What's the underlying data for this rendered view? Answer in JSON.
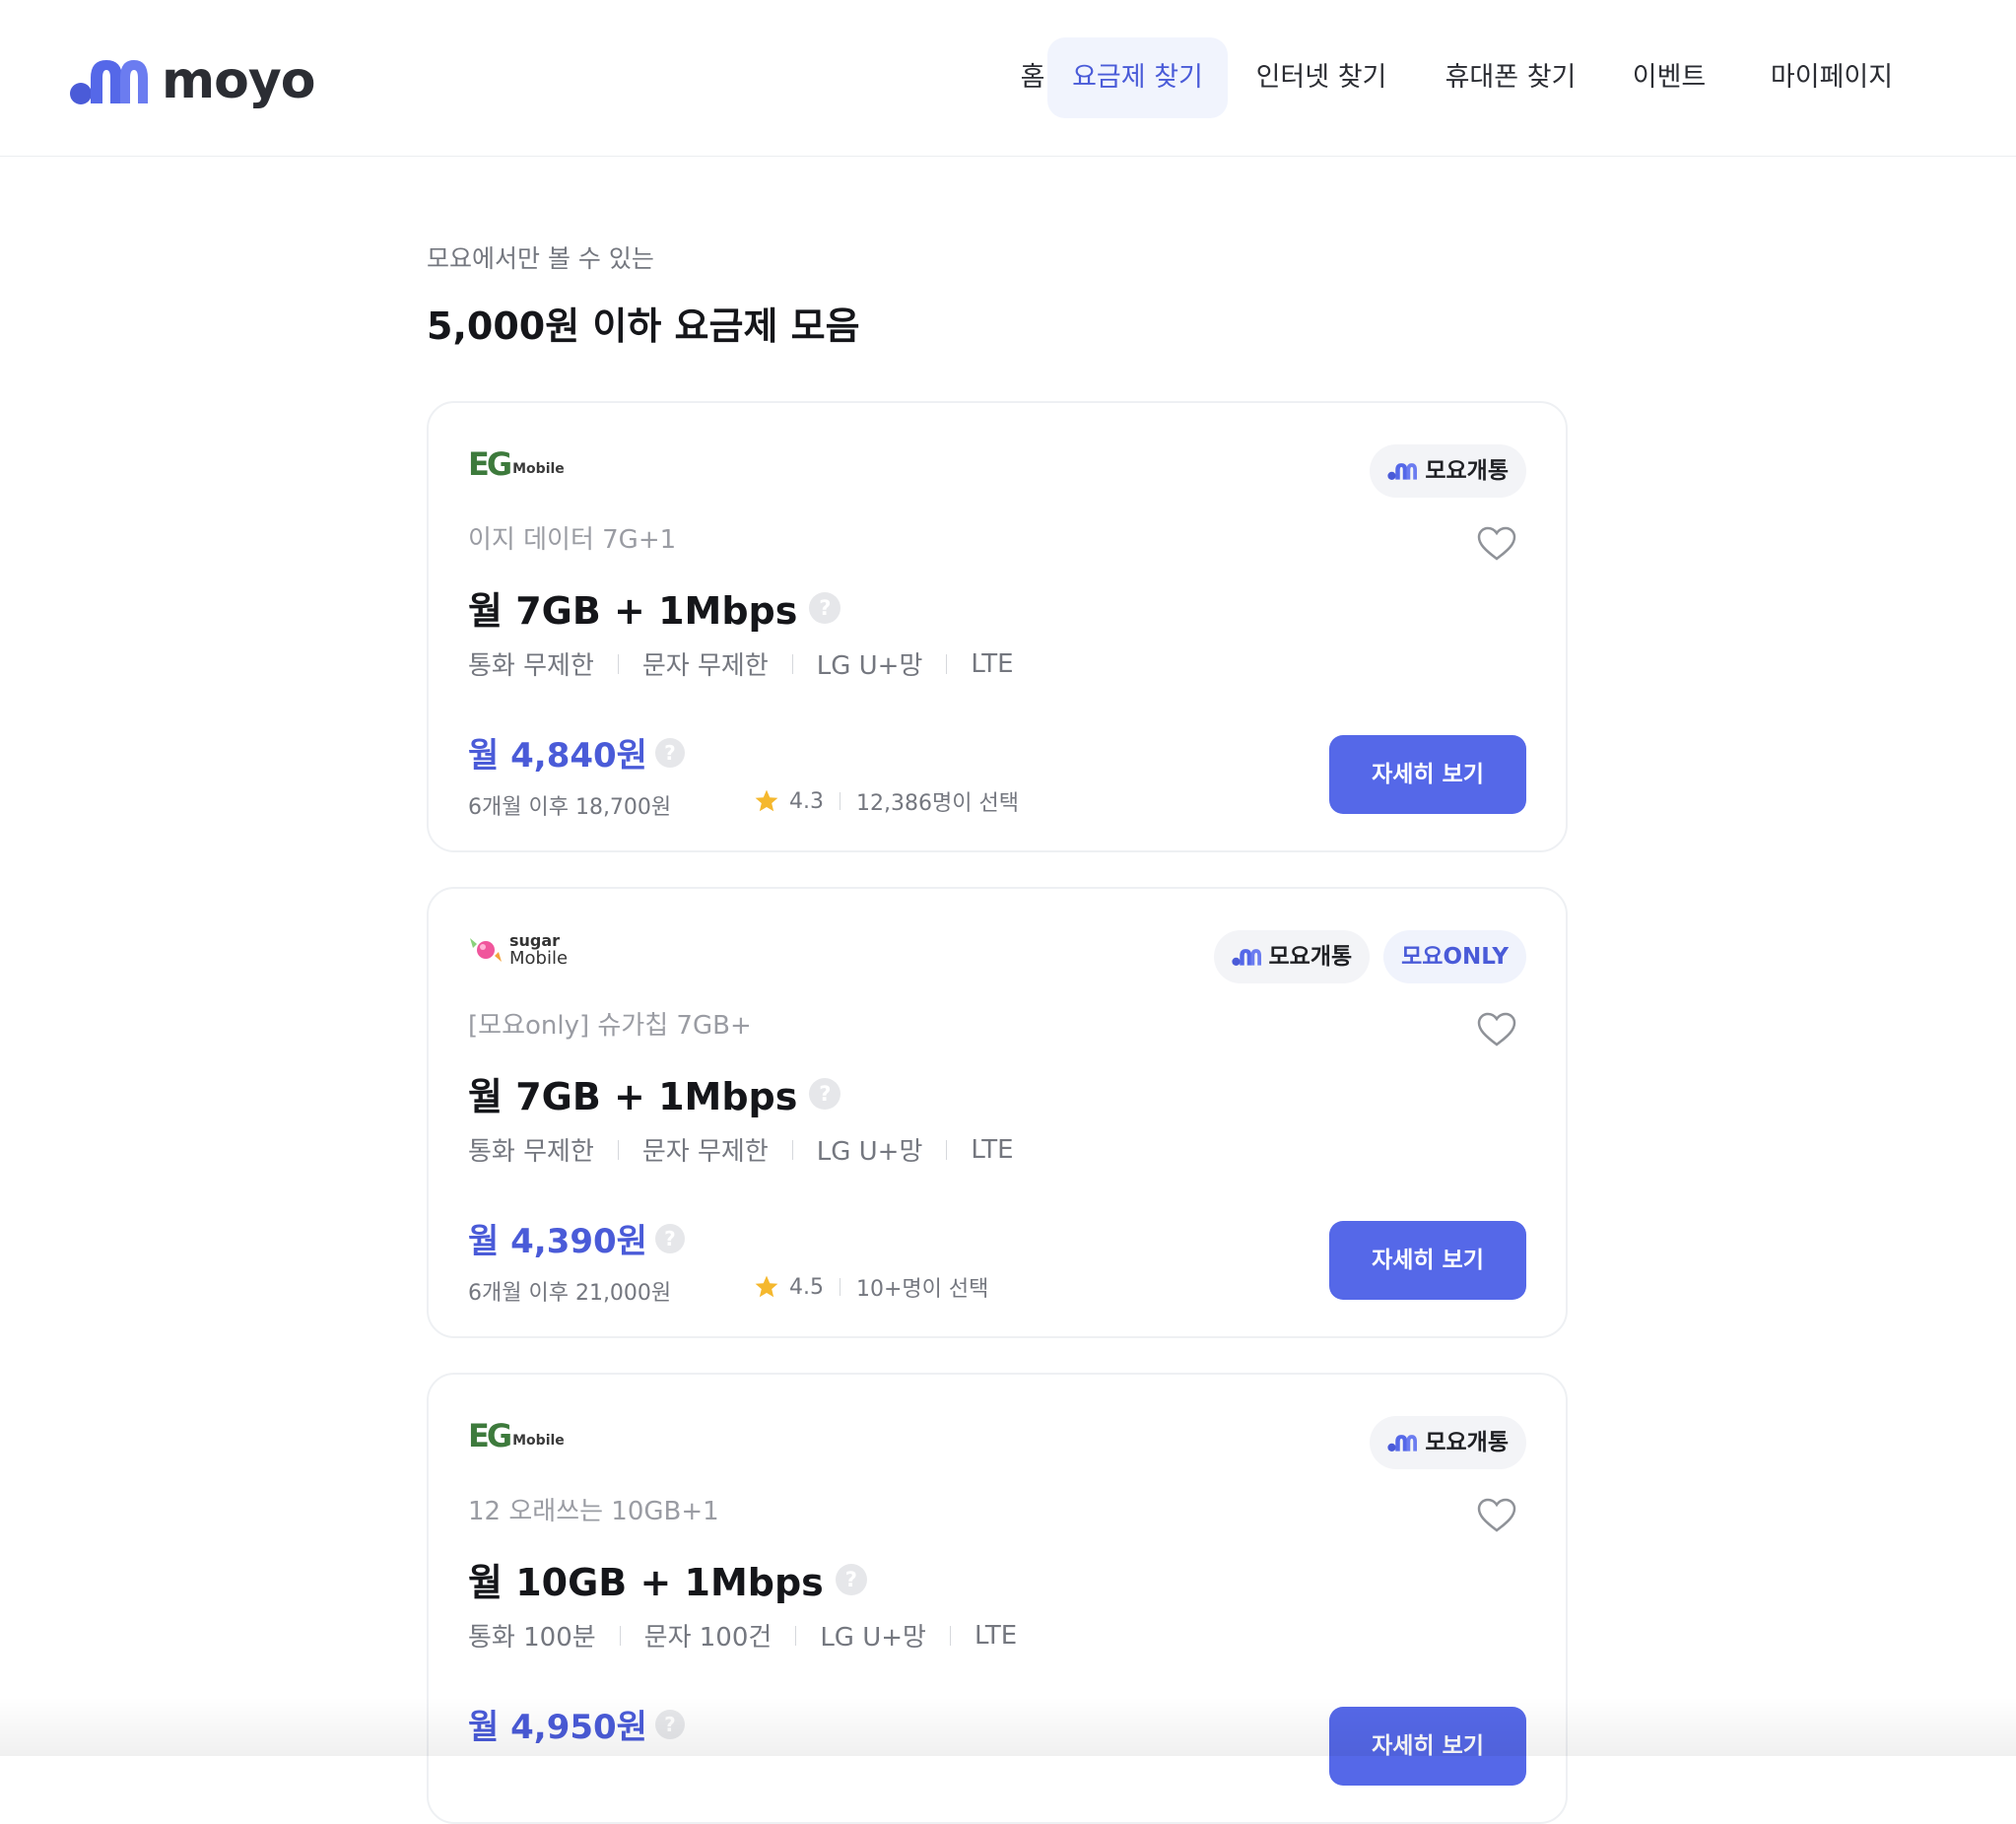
{
  "brand": {
    "name": "moyo",
    "accent_color": "#5568e8",
    "link_color": "#4a5bd8"
  },
  "nav": {
    "items": [
      {
        "label": "홈"
      },
      {
        "label": "요금제 찾기",
        "active": true
      },
      {
        "label": "인터넷 찾기"
      },
      {
        "label": "휴대폰 찾기"
      },
      {
        "label": "이벤트"
      },
      {
        "label": "마이페이지"
      }
    ]
  },
  "intro": {
    "subtitle": "모요에서만 볼 수 있는",
    "title": "5,000원 이하 요금제 모음"
  },
  "plans": [
    {
      "carrier": {
        "name": "EG Mobile",
        "mark": "EG",
        "sub": "Mobile"
      },
      "badges": [
        {
          "label": "모요개통",
          "icon": "moyo-logo-icon"
        }
      ],
      "plan_name": "이지 데이터 7G+1",
      "main": "월 7GB + 1Mbps",
      "features": [
        "통화 무제한",
        "문자 무제한",
        "LG U+망",
        "LTE"
      ],
      "price": "월 4,840원",
      "after_price": "6개월 이후 18,700원",
      "rating": "4.3",
      "selected": "12,386명이 선택",
      "button": "자세히 보기"
    },
    {
      "carrier": {
        "name": "sugar Mobile",
        "top": "sugar",
        "sub": "Mobile"
      },
      "badges": [
        {
          "label": "모요개통",
          "icon": "moyo-logo-icon"
        },
        {
          "label": "모요ONLY"
        }
      ],
      "plan_name": "[모요only] 슈가칩 7GB+",
      "main": "월 7GB + 1Mbps",
      "features": [
        "통화 무제한",
        "문자 무제한",
        "LG U+망",
        "LTE"
      ],
      "price": "월 4,390원",
      "after_price": "6개월 이후 21,000원",
      "rating": "4.5",
      "selected": "10+명이 선택",
      "button": "자세히 보기"
    },
    {
      "carrier": {
        "name": "EG Mobile",
        "mark": "EG",
        "sub": "Mobile"
      },
      "badges": [
        {
          "label": "모요개통",
          "icon": "moyo-logo-icon"
        }
      ],
      "plan_name": "12 오래쓰는 10GB+1",
      "main": "월 10GB + 1Mbps",
      "features": [
        "통화 100분",
        "문자 100건",
        "LG U+망",
        "LTE"
      ],
      "price": "월 4,950원",
      "button": "자세히 보기"
    }
  ],
  "help_glyph": "?"
}
